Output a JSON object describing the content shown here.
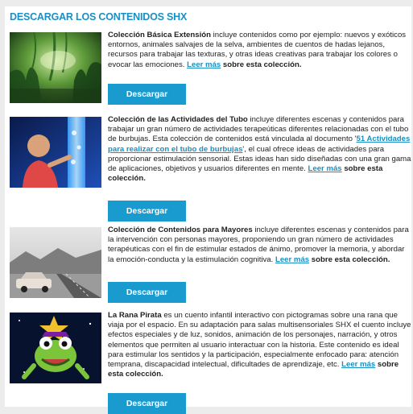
{
  "heading": "DESCARGAR LOS CONTENIDOS SHX",
  "items": [
    {
      "image_alt": "selva",
      "title": "Colección Básica Extensión",
      "text1": " incluye contenidos como por ejemplo: nuevos y exóticos entornos, animales salvajes de la selva, ambientes de cuentos de hadas lejanos, recursos para trabajar las texturas, y otras ideas creativas para trabajar los colores o evocar las emociones. ",
      "link": "Leer más",
      "tail": " sobre esta colección.",
      "button": "Descargar"
    },
    {
      "image_alt": "tubo de burbujas",
      "title": "Colección de las Actividades del Tubo",
      "text1": " incluye diferentes escenas y contenidos para trabajar un gran número de actividades terapeúticas diferentes relacionadas con el tubo de burbujas. Esta colección de contenidos está vinculada al documento '",
      "doc_link": "51 Actividades para realizar con el tubo de burbujas",
      "text2": "', el cual ofrece ideas de actividades para proporcionar estimulación sensorial. Estas ideas han sido diseñadas con una gran gama de aplicaciones, objetivos y usuarios diferentes en mente. ",
      "link": "Leer más",
      "tail": " sobre esta colección.",
      "button": "Descargar"
    },
    {
      "image_alt": "carretera y coche antiguo",
      "title": "Colección de Contenidos para Mayores",
      "text1": " incluye diferentes escenas y contenidos para la intervención con personas mayores, proponiendo un gran número de actividades terapéuticas con el fin de estimular estados de ánimo, promover la memoria, y abordar la emoción-conducta y la estimulación cognitiva. ",
      "link": "Leer más",
      "tail": " sobre esta colección.",
      "button": "Descargar"
    },
    {
      "image_alt": "rana pirata",
      "title": "La Rana Pirata",
      "text1": " es un cuento infantil interactivo con pictogramas sobre una rana que viaja por el espacio. En su adaptación para salas multisensoriales SHX el cuento incluye efectos especiales y de luz, sonidos, animación de los personajes, narración, y otros elementos que permiten al usuario interactuar con la historia. Este contenido es ideal para estimular los sentidos y la participación, especialmente enfocado para: atención temprana, discapacidad intelectual, dificultades de aprendizaje, etc. ",
      "link": "Leer más",
      "tail": " sobre esta colección.",
      "button": "Descargar"
    }
  ],
  "colors": {
    "accent": "#1a8fc4",
    "button": "#1a9bd0"
  }
}
